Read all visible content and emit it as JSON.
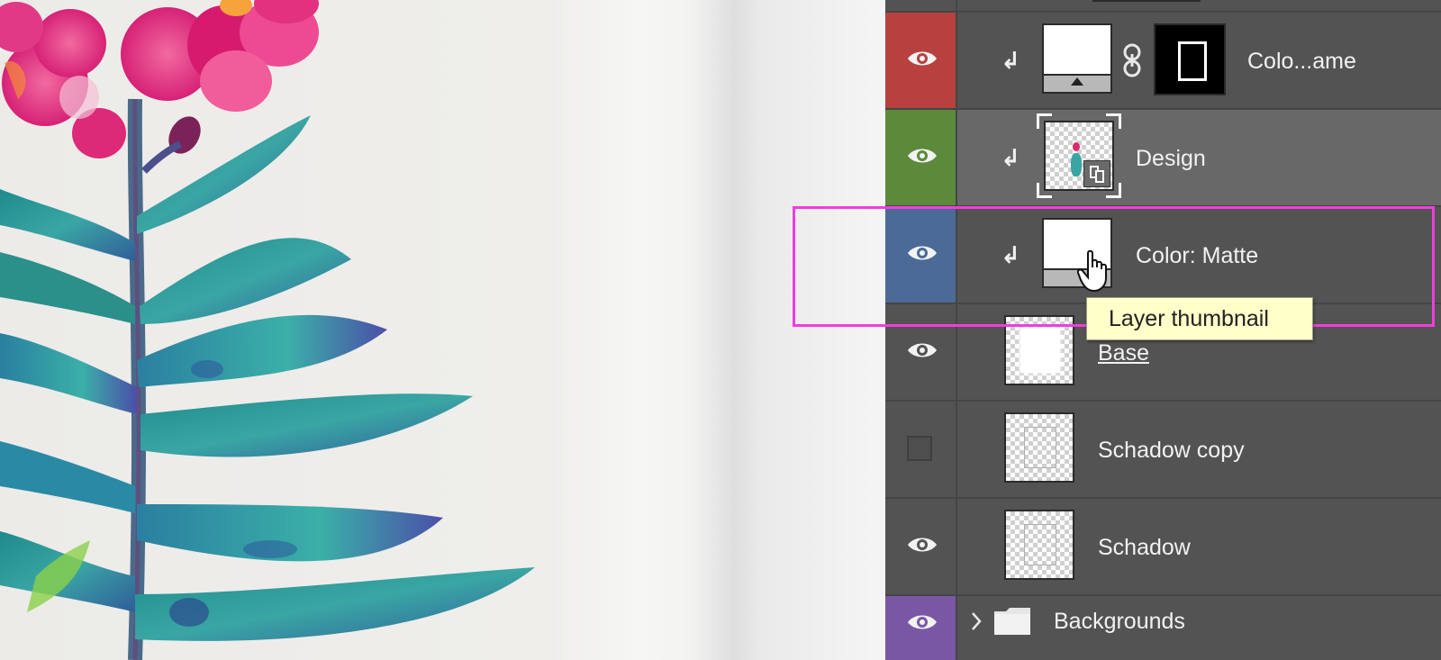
{
  "app": "Photoshop",
  "layers_panel": {
    "layers": [
      {
        "name": "",
        "visible": true,
        "tag_color": "#535353",
        "kind": "partial"
      },
      {
        "name": "Colo...ame",
        "visible": true,
        "tag_color": "#b8413f",
        "clipped": true,
        "thumb": "white-fill",
        "has_mask": true
      },
      {
        "name": "Design",
        "visible": true,
        "tag_color": "#5d893b",
        "clipped": true,
        "thumb": "smart-object",
        "selected": true
      },
      {
        "name": "Color: Matte",
        "visible": true,
        "tag_color": "#4b6a98",
        "clipped": true,
        "thumb": "white-fill",
        "highlighted": true
      },
      {
        "name": "Base",
        "visible": true,
        "tag_color": "#535353",
        "thumb": "transparent"
      },
      {
        "name": "Schadow copy",
        "visible": false,
        "tag_color": "#535353",
        "thumb": "transparent"
      },
      {
        "name": "Schadow",
        "visible": true,
        "tag_color": "#535353",
        "thumb": "transparent"
      },
      {
        "name": "Backgrounds",
        "visible": true,
        "tag_color": "#7a57a5",
        "kind": "group"
      }
    ]
  },
  "tooltip": {
    "text": "Layer thumbnail"
  },
  "icons": {
    "eye": "eye-icon",
    "clip": "clipping-arrow-icon",
    "link": "chain-link-icon",
    "folder": "folder-icon",
    "chevron": "chevron-right-icon",
    "smart_object": "smart-object-badge-icon",
    "cursor": "hand-pointer-cursor-icon"
  },
  "colors": {
    "highlight": "#f23ddd",
    "panel_bg": "#535353",
    "tooltip_bg": "#ffffc9"
  }
}
